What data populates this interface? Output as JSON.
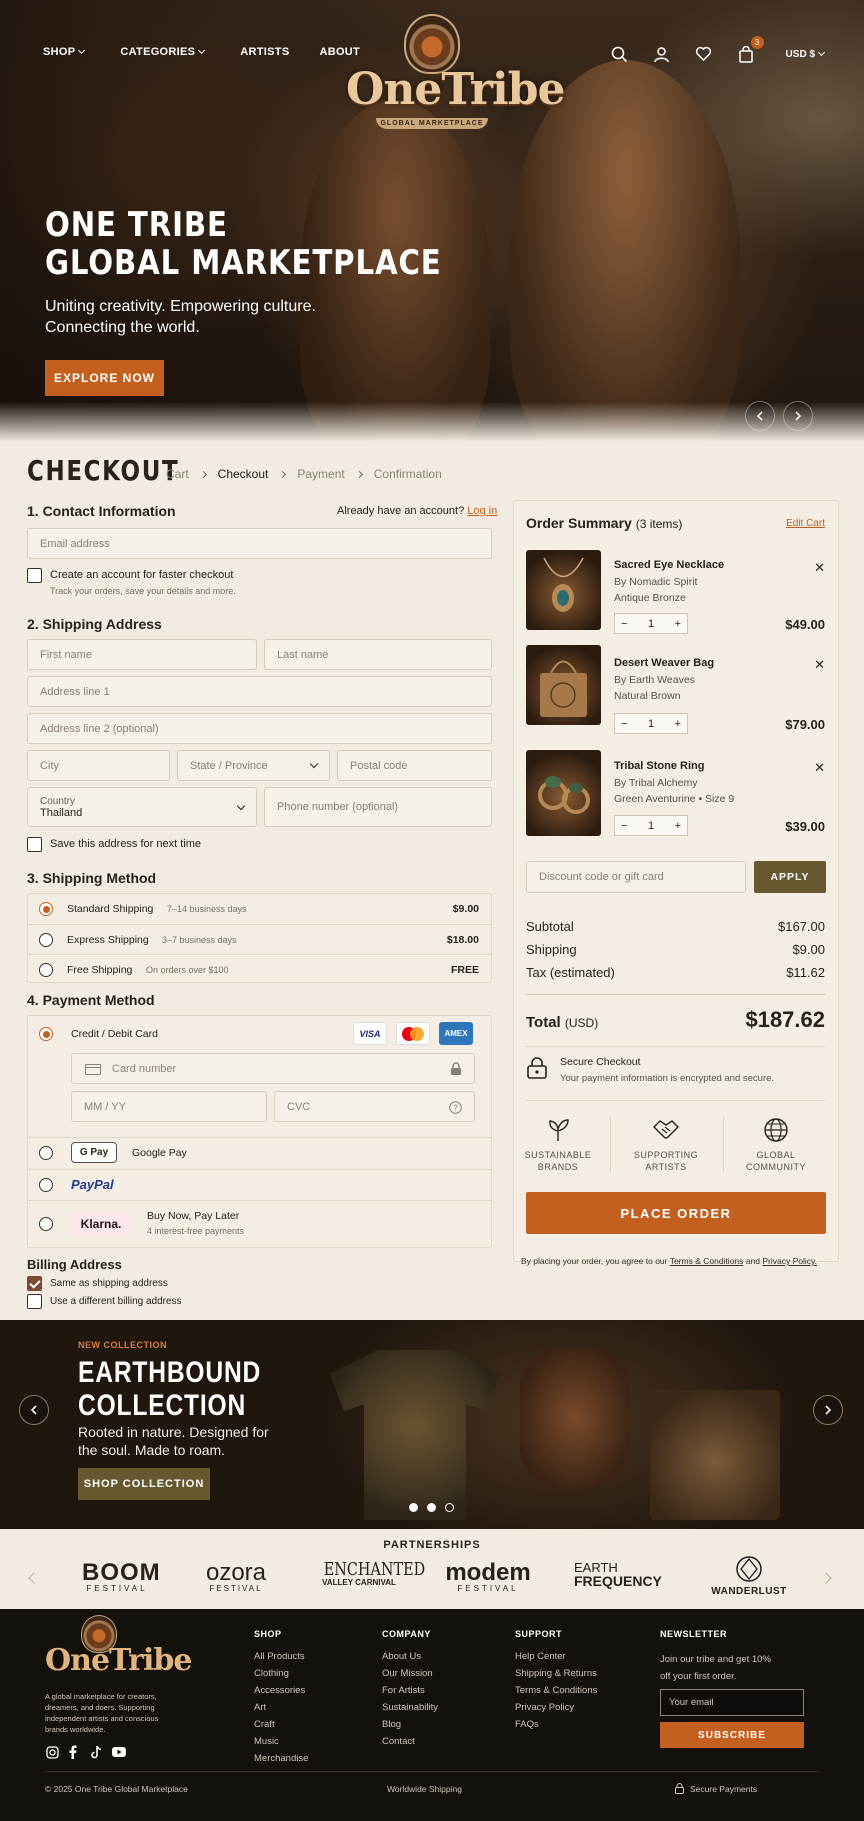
{
  "header": {
    "nav": [
      "SHOP",
      "CATEGORIES",
      "ARTISTS",
      "ABOUT"
    ],
    "logo_text": "OneTribe",
    "logo_sub": "GLOBAL MARKETPLACE",
    "cart_count": "3",
    "currency": "USD $"
  },
  "hero": {
    "title": "ONE TRIBE\nGLOBAL MARKETPLACE",
    "subtitle": "Uniting creativity. Empowering culture.\nConnecting the world.",
    "cta": "EXPLORE NOW"
  },
  "checkout": {
    "title": "CHECKOUT",
    "breadcrumbs": [
      "Cart",
      "Checkout",
      "Payment",
      "Confirmation"
    ]
  },
  "contact": {
    "title": "1. Contact Information",
    "have_account": "Already have an account?",
    "login": "Log in",
    "email_placeholder": "Email address",
    "create_account": "Create an account for faster checkout",
    "create_account_sub": "Track your orders, save your details and more."
  },
  "shipping_address": {
    "title": "2. Shipping Address",
    "first_name": "First name",
    "last_name": "Last name",
    "address1": "Address line 1",
    "address2": "Address line 2 (optional)",
    "city": "City",
    "state": "State / Province",
    "postal": "Postal code",
    "country_label": "Country",
    "country_value": "Thailand",
    "phone": "Phone number (optional)",
    "save": "Save this address for next time"
  },
  "shipping_method": {
    "title": "3. Shipping Method",
    "options": [
      {
        "name": "Standard Shipping",
        "eta": "7–14 business days",
        "price": "$9.00"
      },
      {
        "name": "Express Shipping",
        "eta": "3–7 business days",
        "price": "$18.00"
      },
      {
        "name": "Free Shipping",
        "eta": "On orders over $100",
        "price": "FREE"
      }
    ]
  },
  "payment": {
    "title": "4. Payment Method",
    "card_label": "Credit / Debit Card",
    "card_brands": [
      "VISA",
      "Mastercard",
      "AMEX"
    ],
    "card_number": "Card number",
    "expiry": "MM / YY",
    "cvc": "CVC",
    "gpay_badge": "G Pay",
    "gpay_label": "Google Pay",
    "paypal": "PayPal",
    "klarna": "Klarna.",
    "klarna_label": "Buy Now, Pay Later",
    "klarna_sub": "4 interest-free payments"
  },
  "billing": {
    "title": "Billing Address",
    "same": "Same as shipping address",
    "different": "Use a different billing address"
  },
  "summary": {
    "title": "Order Summary",
    "count": "(3 items)",
    "edit": "Edit Cart",
    "items": [
      {
        "name": "Sacred Eye Necklace",
        "by": "By Nomadic Spirit",
        "variant": "Antique Bronze",
        "qty": "1",
        "price": "$49.00"
      },
      {
        "name": "Desert Weaver Bag",
        "by": "By Earth Weaves",
        "variant": "Natural Brown",
        "qty": "1",
        "price": "$79.00"
      },
      {
        "name": "Tribal Stone Ring",
        "by": "By Tribal Alchemy",
        "variant": "Green Aventurine • Size 9",
        "qty": "1",
        "price": "$39.00"
      }
    ],
    "discount_placeholder": "Discount code or gift card",
    "apply": "APPLY",
    "subtotal_label": "Subtotal",
    "subtotal": "$167.00",
    "shipping_label": "Shipping",
    "shipping": "$9.00",
    "tax_label": "Tax (estimated)",
    "tax": "$11.62",
    "total_label": "Total",
    "total_currency": "(USD)",
    "total": "$187.62",
    "secure_title": "Secure Checkout",
    "secure_sub": "Your payment information is encrypted and secure.",
    "features": [
      {
        "line1": "SUSTAINABLE",
        "line2": "BRANDS"
      },
      {
        "line1": "SUPPORTING",
        "line2": "ARTISTS"
      },
      {
        "line1": "GLOBAL",
        "line2": "COMMUNITY"
      }
    ],
    "place_order": "PLACE ORDER",
    "terms_pre": "By placing your order, you agree to our",
    "terms_link": "Terms & Conditions",
    "terms_and": "and",
    "privacy_link": "Privacy Policy."
  },
  "collection": {
    "label": "NEW COLLECTION",
    "title": "EARTHBOUND\nCOLLECTION",
    "subtitle": "Rooted in nature. Designed for\nthe soul. Made to roam.",
    "cta": "SHOP COLLECTION"
  },
  "partners": {
    "title": "PARTNERSHIPS",
    "logos": [
      {
        "main": "BOOM",
        "sub": "FESTIVAL"
      },
      {
        "main": "ozora",
        "sub": "FESTIVAL"
      },
      {
        "main": "ENCHANTED",
        "sub": "VALLEY CARNIVAL"
      },
      {
        "main": "modem",
        "sub": "FESTIVAL"
      },
      {
        "main": "EARTH",
        "sub": "FREQUENCY"
      },
      {
        "main": "",
        "sub": "WANDERLUST"
      }
    ]
  },
  "footer": {
    "tagline": "A global marketplace for creators, dreamers, and doers. Supporting independent artists and conscious brands worldwide.",
    "shop_title": "SHOP",
    "shop_links": [
      "All Products",
      "Clothing",
      "Accessories",
      "Art",
      "Craft",
      "Music",
      "Merchandise"
    ],
    "company_title": "COMPANY",
    "company_links": [
      "About Us",
      "Our Mission",
      "For Artists",
      "Sustainability",
      "Blog",
      "Contact"
    ],
    "support_title": "SUPPORT",
    "support_links": [
      "Help Center",
      "Shipping & Returns",
      "Terms & Conditions",
      "Privacy Policy",
      "FAQs"
    ],
    "newsletter_title": "NEWSLETTER",
    "newsletter_text": "Join our tribe and get 10% off your first order.",
    "email_placeholder": "Your email",
    "subscribe": "SUBSCRIBE",
    "copyright": "© 2025 One Tribe Global Marketplace",
    "worldwide": "Worldwide Shipping",
    "secure": "Secure Payments"
  },
  "colors": {
    "accent": "#c4601f",
    "background": "#f1ebe1",
    "footer": "#14100c",
    "olive": "#66582f"
  }
}
